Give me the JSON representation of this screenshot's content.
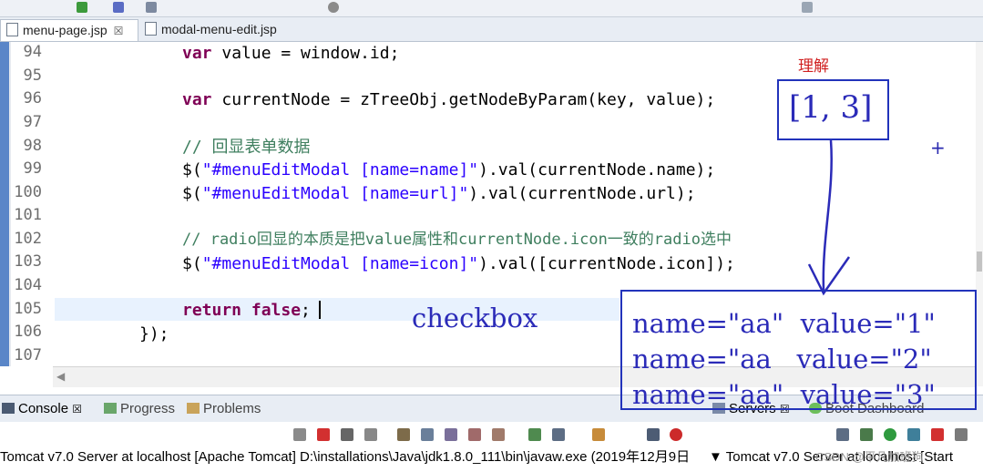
{
  "editor_tabs": [
    {
      "label": "menu-page.jsp",
      "close": "☒"
    },
    {
      "label": "modal-menu-edit.jsp"
    }
  ],
  "code_lines": [
    {
      "num": "94"
    },
    {
      "num": "95"
    },
    {
      "num": "96"
    },
    {
      "num": "97"
    },
    {
      "num": "98"
    },
    {
      "num": "99"
    },
    {
      "num": "100"
    },
    {
      "num": "101"
    },
    {
      "num": "102"
    },
    {
      "num": "103"
    },
    {
      "num": "104"
    },
    {
      "num": "105"
    },
    {
      "num": "106"
    },
    {
      "num": "107"
    }
  ],
  "code": {
    "l94_kw": "var",
    "l94_rest": " value = window.id;",
    "l96_kw": "var",
    "l96_rest": " currentNode = zTreeObj.getNodeByParam(key, value);",
    "l98_comment": "// 回显表单数据",
    "l99_a": "$(",
    "l99_str": "\"#menuEditModal [name=name]\"",
    "l99_b": ").val(currentNode.name);",
    "l100_a": "$(",
    "l100_str": "\"#menuEditModal [name=url]\"",
    "l100_b": ").val(currentNode.url);",
    "l102_comment": "// radio回显的本质是把value属性和currentNode.icon一致的radio选中",
    "l103_a": "$(",
    "l103_str": "\"#menuEditModal [name=icon]\"",
    "l103_b": ").val([currentNode.icon]);",
    "l105_kw": "return false",
    "l105_rest": ";",
    "l106": "});"
  },
  "annotations": {
    "label_red": "理解",
    "array_note": "[1, 3]",
    "checkbox_note": "checkbox",
    "box_line1": "name=\"aa\"  value=\"1\"",
    "box_line2": "name=\"aa   value=\"2\"",
    "box_line3": "name=\"aa\"  value=\"3\"",
    "plus": "+"
  },
  "bottom_panel": {
    "tabs": [
      {
        "label": "Console",
        "close": "☒"
      },
      {
        "label": "Progress"
      },
      {
        "label": "Problems"
      }
    ],
    "servers_tab": {
      "label": "Servers",
      "close": "☒"
    },
    "boot_tab": {
      "label": "Boot Dashboard"
    },
    "console_status": "Tomcat v7.0 Server at localhost [Apache Tomcat] D:\\installations\\Java\\jdk1.8.0_111\\bin\\javaw.exe (2019年12月9日",
    "servers_status": "Tomcat v7.0 Server at localhost [Start"
  },
  "watermark": "CSDN @平凡加班狗",
  "colors": {
    "keyword": "#7f0055",
    "string": "#2a00ff",
    "comment": "#3f7f5f",
    "annotation_blue": "#2b2bb8",
    "annotation_red": "#d02020"
  }
}
